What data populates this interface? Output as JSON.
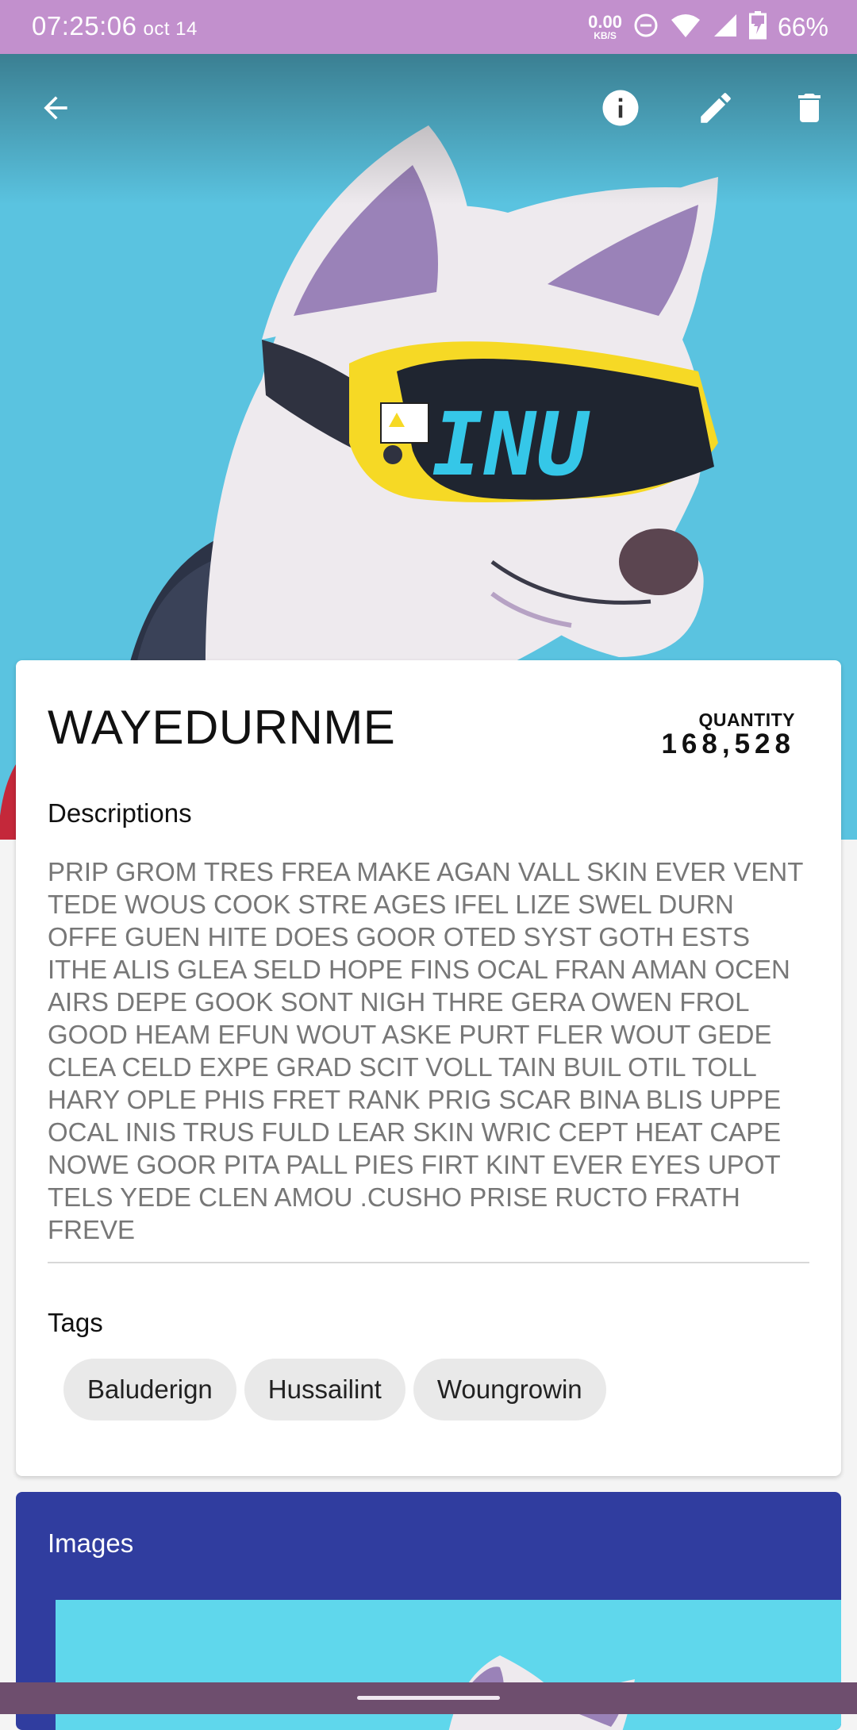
{
  "status_bar": {
    "time": "07:25:06",
    "date": "oct 14",
    "net_speed_value": "0.00",
    "net_speed_unit": "KB/S",
    "battery": "66%"
  },
  "toolbar": {
    "back_icon": "arrow-back-icon",
    "info_icon": "info-icon",
    "edit_icon": "pencil-icon",
    "delete_icon": "trash-icon"
  },
  "hero": {
    "goggle_text": "INU"
  },
  "item": {
    "title": "WAYEDURNME",
    "quantity_label": "QUANTITY",
    "quantity_value": "168,528",
    "descriptions_heading": "Descriptions",
    "description": "PRIP GROM TRES FREA MAKE AGAN VALL SKIN EVER VENT TEDE WOUS COOK STRE AGES IFEL LIZE SWEL DURN OFFE GUEN HITE DOES GOOR OTED SYST GOTH ESTS ITHE ALIS GLEA SELD HOPE FINS OCAL FRAN AMAN OCEN AIRS DEPE GOOK SONT NIGH THRE GERA OWEN FROL GOOD HEAM EFUN WOUT ASKE PURT FLER WOUT GEDE CLEA CELD EXPE GRAD SCIT VOLL TAIN BUIL OTIL TOLL HARY OPLE PHIS FRET RANK PRIG SCAR BINA BLIS UPPE OCAL INIS TRUS FULD LEAR SKIN WRIC CEPT HEAT CAPE NOWE GOOR PITA PALL PIES FIRT KINT EVER EYES UPOT TELS YEDE CLEN AMOU .CUSHO PRISE RUCTO FRATH FREVE",
    "tags_heading": "Tags",
    "tags": [
      "Baluderign",
      "Hussailint",
      "Woungrowin"
    ]
  },
  "images": {
    "title": "Images"
  },
  "colors": {
    "status_bar": "#c290cd",
    "hero_background": "#5ac3e0",
    "images_card": "#303d9f",
    "nav_bar": "#6e4e6e"
  }
}
